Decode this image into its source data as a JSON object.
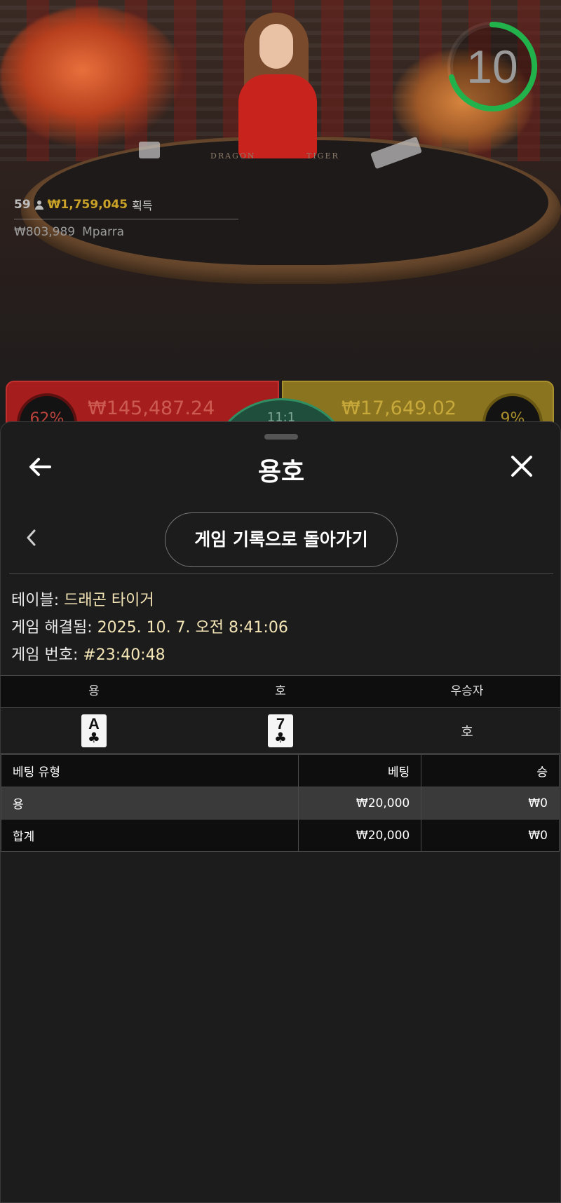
{
  "stage": {
    "table_text_left": "DRAGON",
    "table_text_right": "TIGER",
    "player_count": "59",
    "won_amount": "₩1,759,045",
    "won_label": "획득",
    "recent_win_amount": "₩803,989",
    "recent_win_player": "Mparra",
    "timer_value": "10"
  },
  "bets": {
    "dragon_amount": "₩145,487.24",
    "dragon_percent": "62%",
    "tiger_amount": "₩17,649.02",
    "tiger_percent": "9%",
    "tie_payout": "11:1"
  },
  "sheet": {
    "title": "용호",
    "history_button_label": "게임 기록으로 돌아가기",
    "table_label": "테이블:",
    "table_value": "드래곤 타이거",
    "resolved_label": "게임 해결됨:",
    "resolved_value": "2025. 10. 7. 오전 8:41:06",
    "game_number_label": "게임 번호:",
    "game_number_value": "#23:40:48"
  },
  "results": {
    "headers": [
      "용",
      "호",
      "우승자"
    ],
    "dragon_card": {
      "rank": "A",
      "suit": "♣"
    },
    "tiger_card": {
      "rank": "7",
      "suit": "♣"
    },
    "winner": "호"
  },
  "bet_table": {
    "headers": [
      "베팅 유형",
      "베팅",
      "승"
    ],
    "rows": [
      {
        "type": "용",
        "bet": "₩20,000",
        "win": "₩0"
      },
      {
        "type": "합계",
        "bet": "₩20,000",
        "win": "₩0"
      }
    ]
  },
  "colors": {
    "accent_gold": "#c9a227",
    "timer_green": "#22b24c",
    "info_value": "#f4e5b6"
  }
}
